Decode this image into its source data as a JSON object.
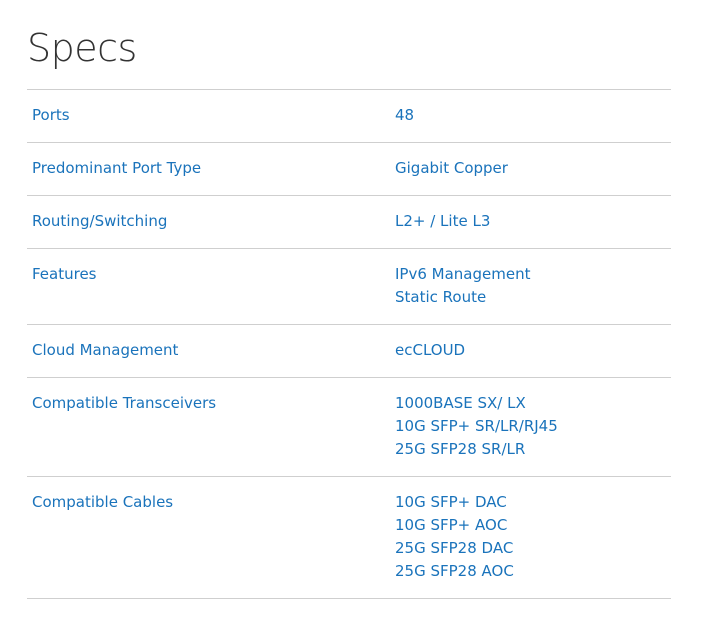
{
  "title": "Specs",
  "rows": [
    {
      "label": "Ports",
      "values": [
        "48"
      ]
    },
    {
      "label": "Predominant Port Type",
      "values": [
        "Gigabit Copper"
      ]
    },
    {
      "label": "Routing/Switching",
      "values": [
        "L2+ / Lite L3"
      ]
    },
    {
      "label": "Features",
      "values": [
        "IPv6 Management",
        "Static Route"
      ]
    },
    {
      "label": "Cloud Management",
      "values": [
        "ecCLOUD"
      ]
    },
    {
      "label": "Compatible Transceivers",
      "values": [
        "1000BASE SX/ LX",
        "10G SFP+ SR/LR/RJ45",
        "25G SFP28 SR/LR"
      ]
    },
    {
      "label": "Compatible Cables",
      "values": [
        "10G SFP+ DAC",
        "10G SFP+ AOC",
        "25G SFP28 DAC",
        "25G SFP28 AOC"
      ]
    }
  ],
  "colors": {
    "link": "#1a73bb",
    "title": "#333333",
    "divider": "#cfcfcf"
  }
}
